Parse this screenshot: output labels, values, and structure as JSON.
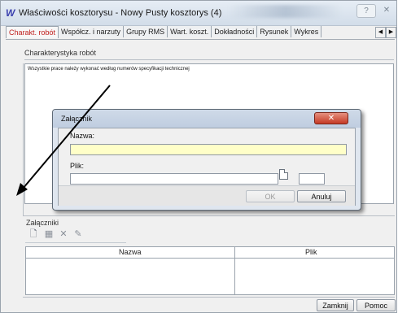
{
  "window": {
    "title": "Właściwości kosztorysu - Nowy  Pusty kosztorys (4)",
    "app_icon": "W",
    "help_label": "?",
    "close_label": "✕"
  },
  "tabs": [
    {
      "label": "Charakt. robót",
      "active": true
    },
    {
      "label": "Współcz. i narzuty",
      "active": false
    },
    {
      "label": "Grupy RMS",
      "active": false
    },
    {
      "label": "Wart. koszt.",
      "active": false
    },
    {
      "label": "Dokładności",
      "active": false
    },
    {
      "label": "Rysunek",
      "active": false
    },
    {
      "label": "Wykres",
      "active": false
    }
  ],
  "tab_scroll": {
    "left": "◀",
    "right": "▶"
  },
  "characteristics": {
    "group_label": "Charakterystyka robót",
    "text": "Wszystkie prace należy wykonać według numerów specyfikacji technicznej"
  },
  "attachments": {
    "group_label": "Załączniki",
    "toolbar_icons": [
      "new-document-icon",
      "edit-icon",
      "delete-icon",
      "tools-icon"
    ],
    "columns": [
      "Nazwa",
      "Plik"
    ]
  },
  "buttons": {
    "close": "Zamknij",
    "help": "Pomoc"
  },
  "dialog": {
    "title": "Załącznik",
    "close_label": "✕",
    "name_label": "Nazwa:",
    "name_value": "",
    "file_label": "Plik:",
    "file_value": "",
    "ok": "OK",
    "cancel": "Anuluj"
  },
  "colors": {
    "active_tab": "#c0201e",
    "name_field_bg": "#ffffc8",
    "dialog_close": "#c53a25"
  }
}
